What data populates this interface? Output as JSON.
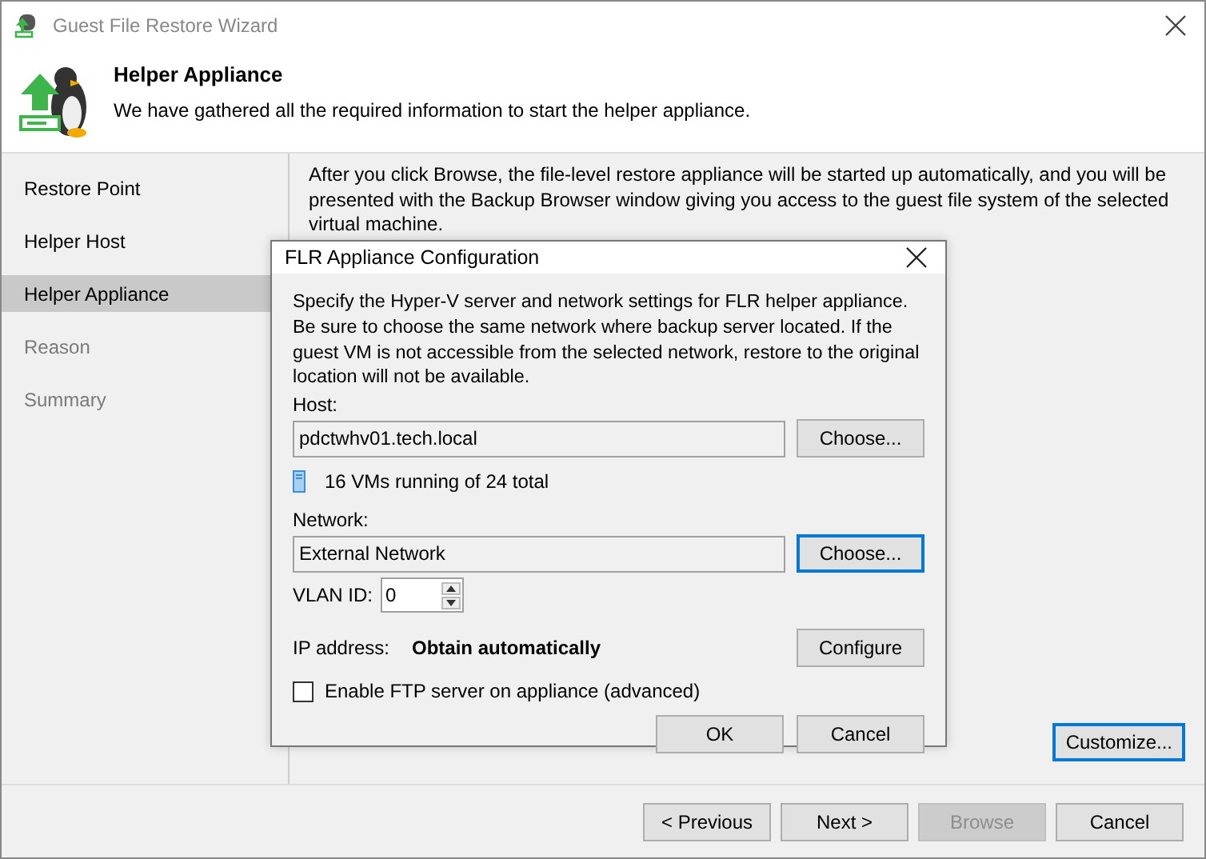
{
  "window": {
    "title": "Guest File Restore Wizard"
  },
  "header": {
    "title": "Helper Appliance",
    "subtitle": "We have gathered all the required information to start the helper appliance."
  },
  "steps": [
    {
      "label": "Restore Point",
      "selected": false,
      "disabled": false
    },
    {
      "label": "Helper Host",
      "selected": false,
      "disabled": false
    },
    {
      "label": "Helper Appliance",
      "selected": true,
      "disabled": false
    },
    {
      "label": "Reason",
      "selected": false,
      "disabled": true
    },
    {
      "label": "Summary",
      "selected": false,
      "disabled": true
    }
  ],
  "content": {
    "description": "After you click Browse, the file-level restore appliance will be started up automatically, and you will be presented with the Backup Browser window giving you access to the guest file system of the selected virtual machine.",
    "customize_button": {
      "label": "Customize...",
      "focused": true
    }
  },
  "footer_buttons": [
    {
      "label": "< Previous",
      "disabled": false
    },
    {
      "label": "Next >",
      "disabled": false
    },
    {
      "label": "Browse",
      "disabled": true
    },
    {
      "label": "Cancel",
      "disabled": false
    }
  ],
  "dialog": {
    "title": "FLR Appliance Configuration",
    "description": "Specify the Hyper-V server and network settings for FLR helper appliance. Be sure to choose the same network where backup server located. If the guest VM is not accessible from the selected network, restore to the original location will not be available.",
    "host": {
      "label": "Host:",
      "value": "pdctwhv01.tech.local",
      "button": {
        "label": "Choose...",
        "focused": false
      }
    },
    "vm_count": "16 VMs running of 24 total",
    "network": {
      "label": "Network:",
      "value": "External Network",
      "button": {
        "label": "Choose...",
        "focused": true
      }
    },
    "vlan": {
      "label": "VLAN ID:",
      "value": "0"
    },
    "ip": {
      "label": "IP address:",
      "value": "Obtain automatically",
      "button": "Configure"
    },
    "ftp": {
      "label": "Enable FTP server on appliance (advanced)",
      "checked": false
    },
    "buttons": [
      "OK",
      "Cancel"
    ]
  }
}
